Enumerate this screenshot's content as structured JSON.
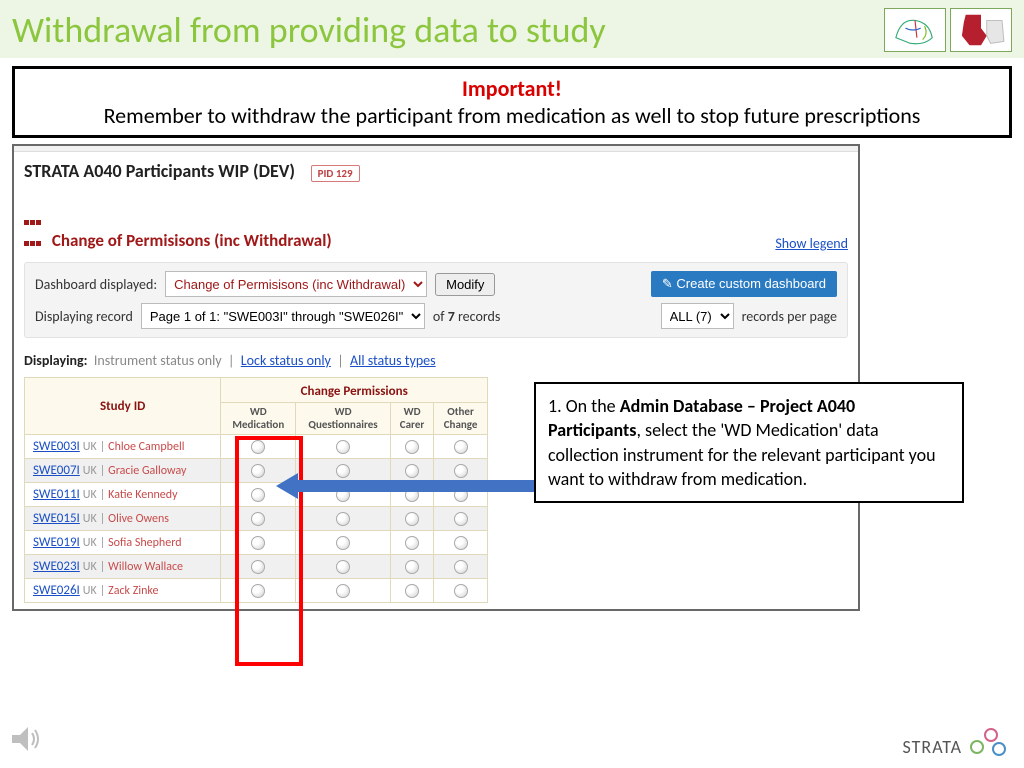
{
  "header": {
    "title": "Withdrawal from providing data to study"
  },
  "important": {
    "heading": "Important!",
    "text": "Remember to withdraw the participant from medication as well to stop future prescriptions"
  },
  "app": {
    "title": "STRATA A040 Participants WIP (DEV)",
    "pid_badge": "PID  129",
    "section_title": "Change of Permisisons (inc Withdrawal)",
    "show_legend": "Show legend",
    "controls": {
      "dash_label": "Dashboard displayed:",
      "dash_option": "Change of Permisisons (inc Withdrawal)",
      "modify": "Modify",
      "create": "Create custom dashboard",
      "displaying_record": "Displaying record",
      "page_option": "Page 1 of 1: \"SWE003I\" through \"SWE026I\"",
      "of_records": "of 7 records",
      "all_option": "ALL (7)",
      "per_page": "records per page"
    },
    "displaying": {
      "label": "Displaying:",
      "instrument": "Instrument status only",
      "lock": "Lock status only",
      "all": "All status types"
    },
    "table": {
      "group_header": "Change Permissions",
      "study_id": "Study ID",
      "cols": [
        "WD Medication",
        "WD Questionnaires",
        "WD Carer",
        "Other Change"
      ],
      "rows": [
        {
          "id": "SWE003I",
          "loc": "UK",
          "name": "Chloe Campbell"
        },
        {
          "id": "SWE007I",
          "loc": "UK",
          "name": "Gracie Galloway"
        },
        {
          "id": "SWE011I",
          "loc": "UK",
          "name": "Katie Kennedy"
        },
        {
          "id": "SWE015I",
          "loc": "UK",
          "name": "Olive Owens"
        },
        {
          "id": "SWE019I",
          "loc": "UK",
          "name": "Sofia Shepherd"
        },
        {
          "id": "SWE023I",
          "loc": "UK",
          "name": "Willow Wallace"
        },
        {
          "id": "SWE026I",
          "loc": "UK",
          "name": "Zack Zinke"
        }
      ]
    }
  },
  "callout": {
    "num": "1.",
    "pre": " On the ",
    "bold": "Admin Database – Project A040 Participants",
    "post": ", select the 'WD Medication' data collection instrument for the relevant participant you want to withdraw from medication."
  },
  "footer": {
    "strata": "STRATA"
  }
}
